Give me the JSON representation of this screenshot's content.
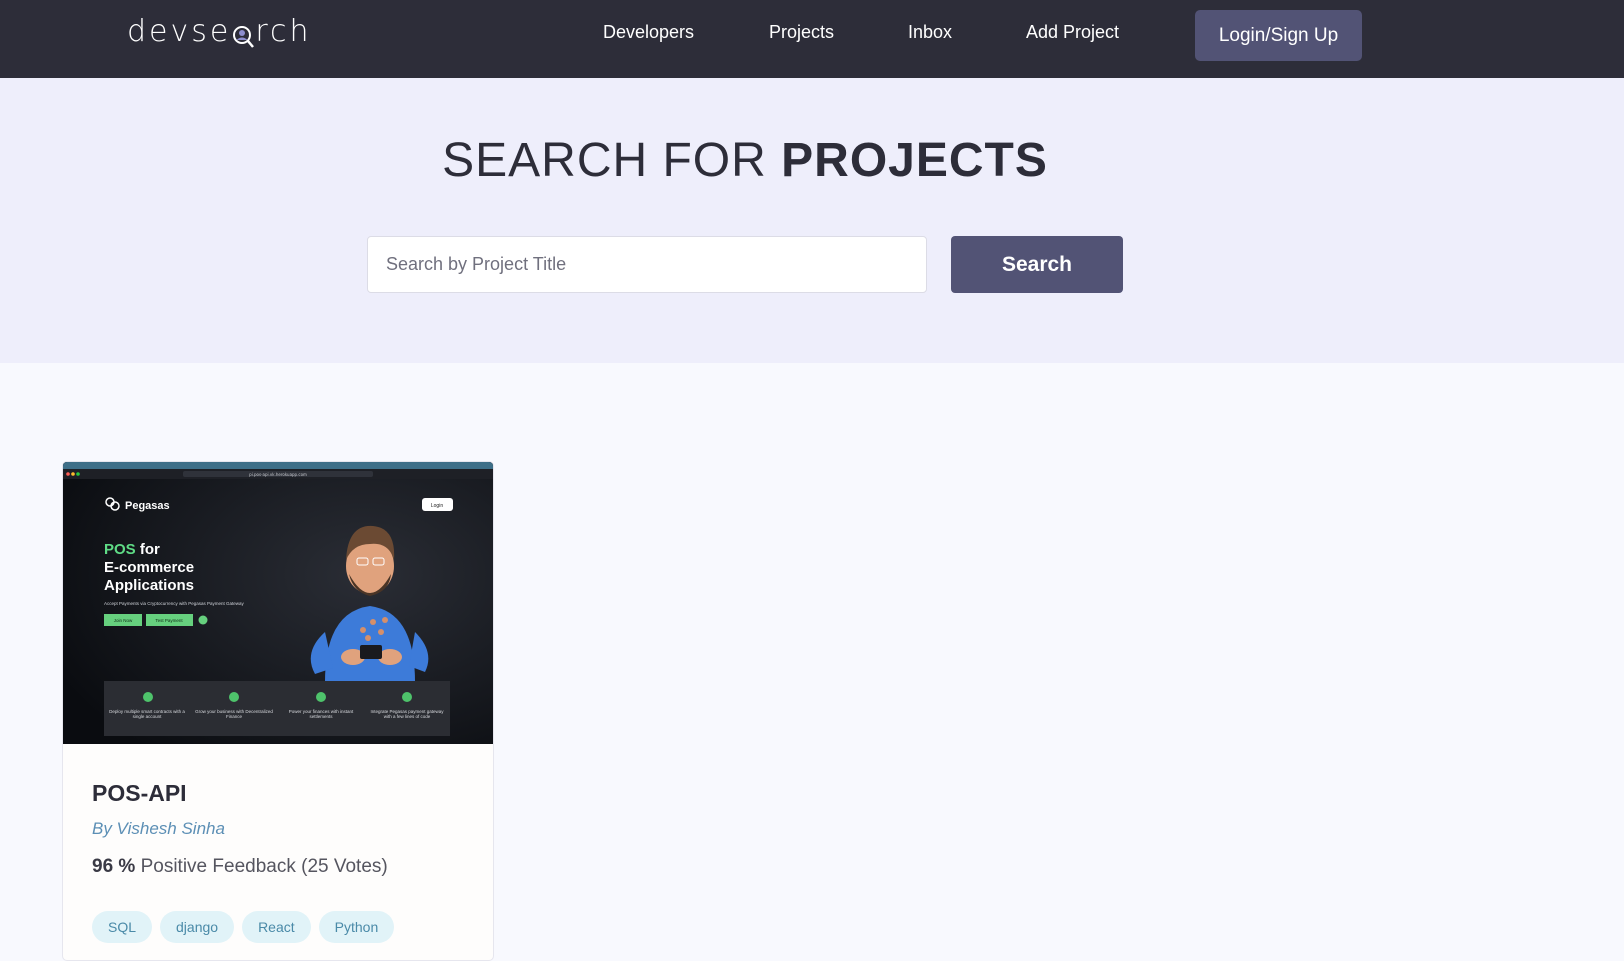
{
  "header": {
    "logo_left": "devse",
    "logo_right": "rch",
    "nav": [
      "Developers",
      "Projects",
      "Inbox",
      "Add Project"
    ],
    "login_label": "Login/Sign Up"
  },
  "hero": {
    "title_light": "SEARCH FOR ",
    "title_bold": "PROJECTS",
    "search_placeholder": "Search by Project Title",
    "search_button": "Search"
  },
  "projects": [
    {
      "title": "POS-API",
      "author": "By Vishesh Sinha",
      "feedback_percent": "96 %",
      "feedback_text": " Positive Feedback (25 Votes)",
      "tags": [
        "SQL",
        "django",
        "React",
        "Python"
      ],
      "thumbnail": {
        "brand": "Pegasas",
        "login": "Login",
        "headline_accent": "POS",
        "headline_1": " for",
        "headline_2": "E-commerce",
        "headline_3": "Applications",
        "tagline": "Accept Payments via Cryptocurrency with Pegasas Payment Gateway",
        "btn_1": "Join Now",
        "btn_2": "Test Payment",
        "features": [
          "Deploy multiple smart contracts with a single account",
          "Grow your business with Decentralized Finance",
          "Power your finances with instant settlements",
          "Integrate Pegasas payment gateway with a few lines of code"
        ],
        "url": "pi.pos-api.vk.herokuapp.com"
      }
    }
  ],
  "colors": {
    "header_bg": "#2d2d39",
    "accent": "#525375",
    "hero_bg": "#eeeefb",
    "page_bg": "#f8f9fe",
    "tag_bg": "#e1f3f8",
    "tag_text": "#4a8aa8",
    "author": "#5c8fb5"
  }
}
